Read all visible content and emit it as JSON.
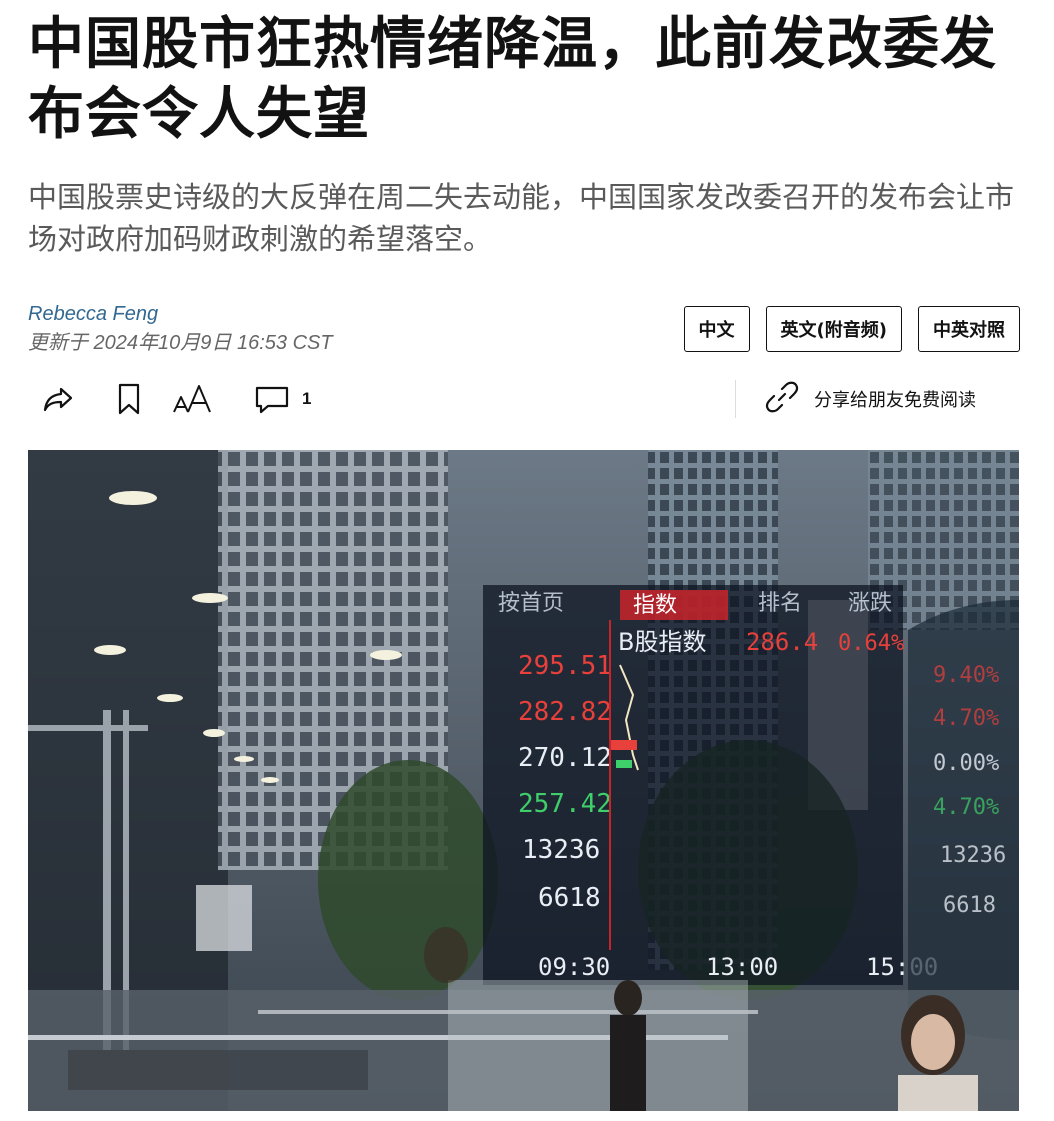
{
  "article": {
    "headline": "中国股市狂热情绪降温，此前发改委发布会令人失望",
    "summary": "中国股票史诗级的大反弹在周二失去动能，中国国家发改委召开的发布会让市场对政府加码财政刺激的希望落空。",
    "author": "Rebecca Feng",
    "dateline": "更新于 2024年10月9日 16:53 CST"
  },
  "language_switch": {
    "chinese": "中文",
    "english_audio": "英文(附音频)",
    "bilingual": "中英对照"
  },
  "toolbar": {
    "share_icon": "share-icon",
    "bookmark_icon": "bookmark-icon",
    "font_size_icon": "font-size-icon",
    "comment_icon": "comment-icon",
    "comment_count": "1",
    "gift_icon": "gift-link-icon",
    "gift_label": "分享给朋友免费阅读"
  },
  "photo": {
    "board_header": [
      "按首页",
      "指数",
      "排名",
      "涨跌"
    ],
    "board_index_label": "B股指数",
    "board_index_value": "286.4",
    "board_index_change": "0.64%",
    "board_values": [
      "295.51",
      "282.82",
      "270.12",
      "257.42",
      "13236",
      "6618"
    ],
    "board_times": [
      "09:30",
      "13:00",
      "15:00"
    ],
    "board_right_values": [
      "9.40%",
      "4.70%",
      "0.00%",
      "4.70%",
      "13236",
      "6618"
    ],
    "colors": {
      "red": "#e8403a",
      "green": "#3ecf6a",
      "white": "#e9eef5"
    }
  }
}
